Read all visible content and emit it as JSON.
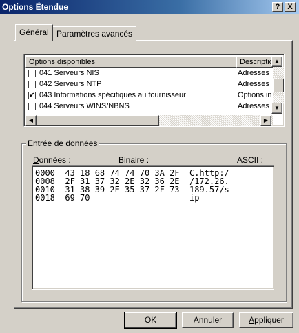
{
  "window": {
    "title": "Options Étendue",
    "help_glyph": "?",
    "close_glyph": "X"
  },
  "tabs": [
    {
      "label": "Général",
      "active": true
    },
    {
      "label": "Paramètres avancés",
      "active": false
    }
  ],
  "options_list": {
    "columns": [
      "Options disponibles",
      "Descriptio"
    ],
    "rows": [
      {
        "name": "041 Serveurs NIS",
        "description": "Adresses",
        "checked": false
      },
      {
        "name": "042 Serveurs NTP",
        "description": "Adresses",
        "checked": false
      },
      {
        "name": "043 Informations spécifiques au fournisseur",
        "description": "Options in",
        "checked": true
      },
      {
        "name": "044 Serveurs WINS/NBNS",
        "description": "Adresses",
        "checked": false
      }
    ],
    "check_glyph": "✔",
    "arrows": {
      "up": "▲",
      "down": "▼",
      "left": "◀",
      "right": "▶"
    }
  },
  "data_entry": {
    "group_label": "Entrée de données",
    "data_label_key": "D",
    "data_label_rest": "onnées :",
    "binary_label": "Binaire :",
    "ascii_label": "ASCII :",
    "hex_rows": [
      {
        "offset": "0000",
        "bytes": "43 18 68 74 74 70 3A 2F",
        "ascii": "C.http:/"
      },
      {
        "offset": "0008",
        "bytes": "2F 31 37 32 2E 32 36 2E",
        "ascii": "/172.26."
      },
      {
        "offset": "0010",
        "bytes": "31 38 39 2E 35 37 2F 73",
        "ascii": "189.57/s"
      },
      {
        "offset": "0018",
        "bytes": "69 70",
        "ascii": "ip"
      }
    ]
  },
  "buttons": {
    "ok": "OK",
    "cancel": "Annuler",
    "apply_key": "A",
    "apply_rest": "ppliquer"
  }
}
